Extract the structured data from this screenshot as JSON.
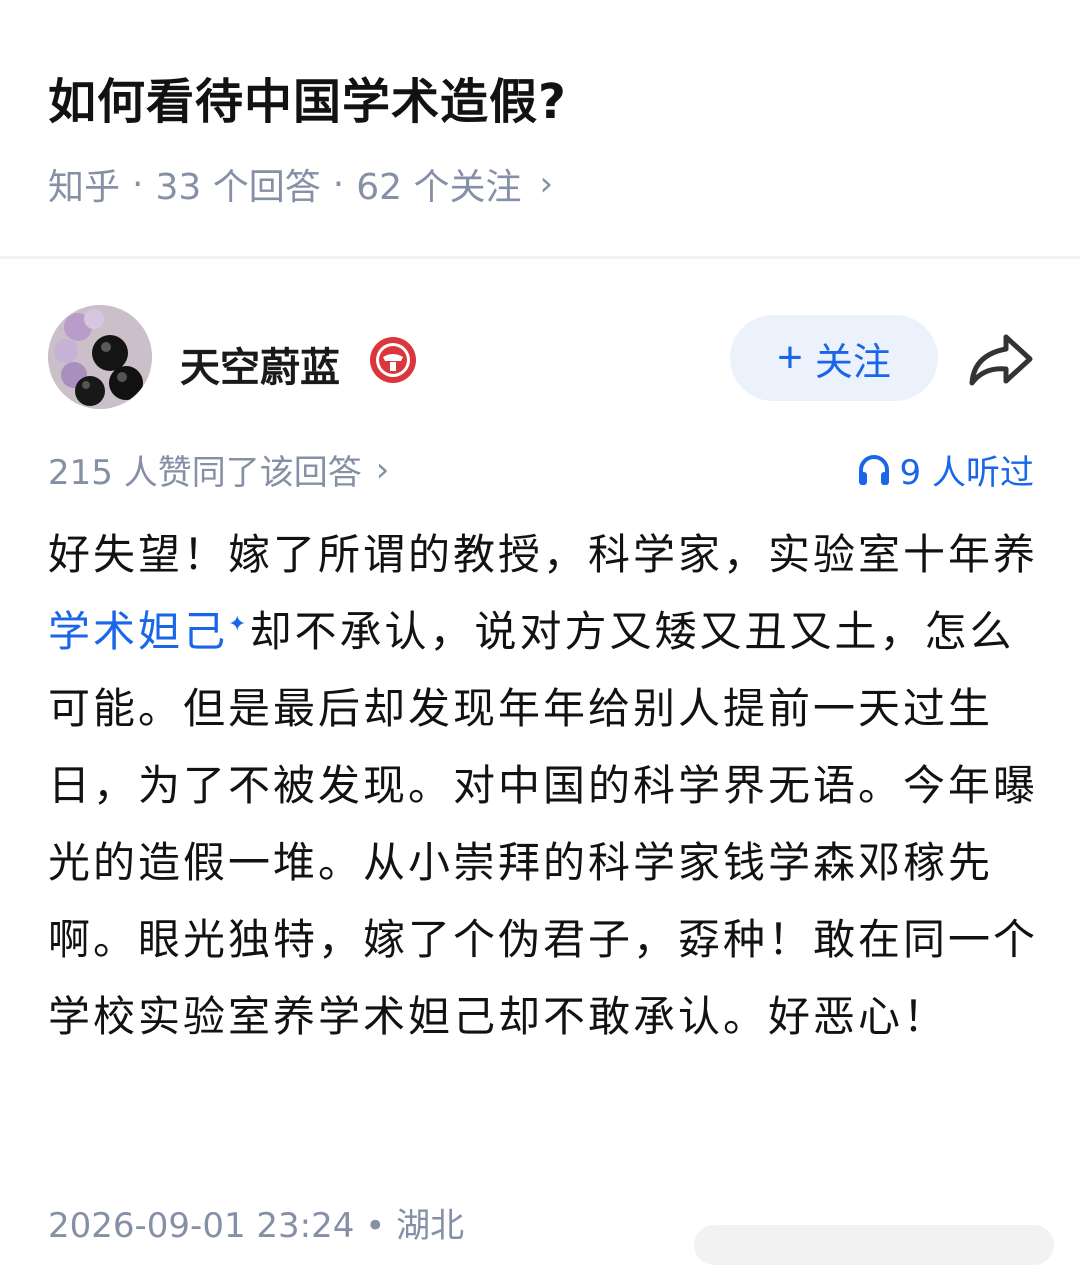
{
  "question": {
    "title": "如何看待中国学术造假?",
    "source": "知乎",
    "answers": "33 个回答",
    "followers": "62 个关注",
    "separator": "·",
    "chevron": "›"
  },
  "author": {
    "name": "天空蔚蓝",
    "follow_plus": "+",
    "follow_label": "关注"
  },
  "stats": {
    "upvotes": "215 人赞同了该回答",
    "chevron": "›",
    "listened": "9 人听过"
  },
  "answer": {
    "part1": "好失望！嫁了所谓的教授，科学家，实验室十年养",
    "link": "学术妲己",
    "sparkle": "✦",
    "part2": "却不承认，说对方又矮又丑又土，怎么可能。但是最后却发现年年给别人提前一天过生日，为了不被发现。对中国的科学界无语。今年曝光的造假一堆。从小崇拜的科学家钱学森邓稼先啊。眼光独特，嫁了个伪君子，孬种！敢在同一个学校实验室养学术妲己却不敢承认。好恶心！"
  },
  "footer": {
    "timestamp": "2026-09-01 23:24",
    "dot": "•",
    "location": "湖北"
  },
  "icons": {
    "badge": "badge-icon",
    "share": "share-icon",
    "headphone": "headphone-icon"
  },
  "colors": {
    "accent": "#1a66e8",
    "muted": "#8590a6",
    "follow_bg": "#ebf2fc",
    "badge_red": "#d9363e"
  }
}
